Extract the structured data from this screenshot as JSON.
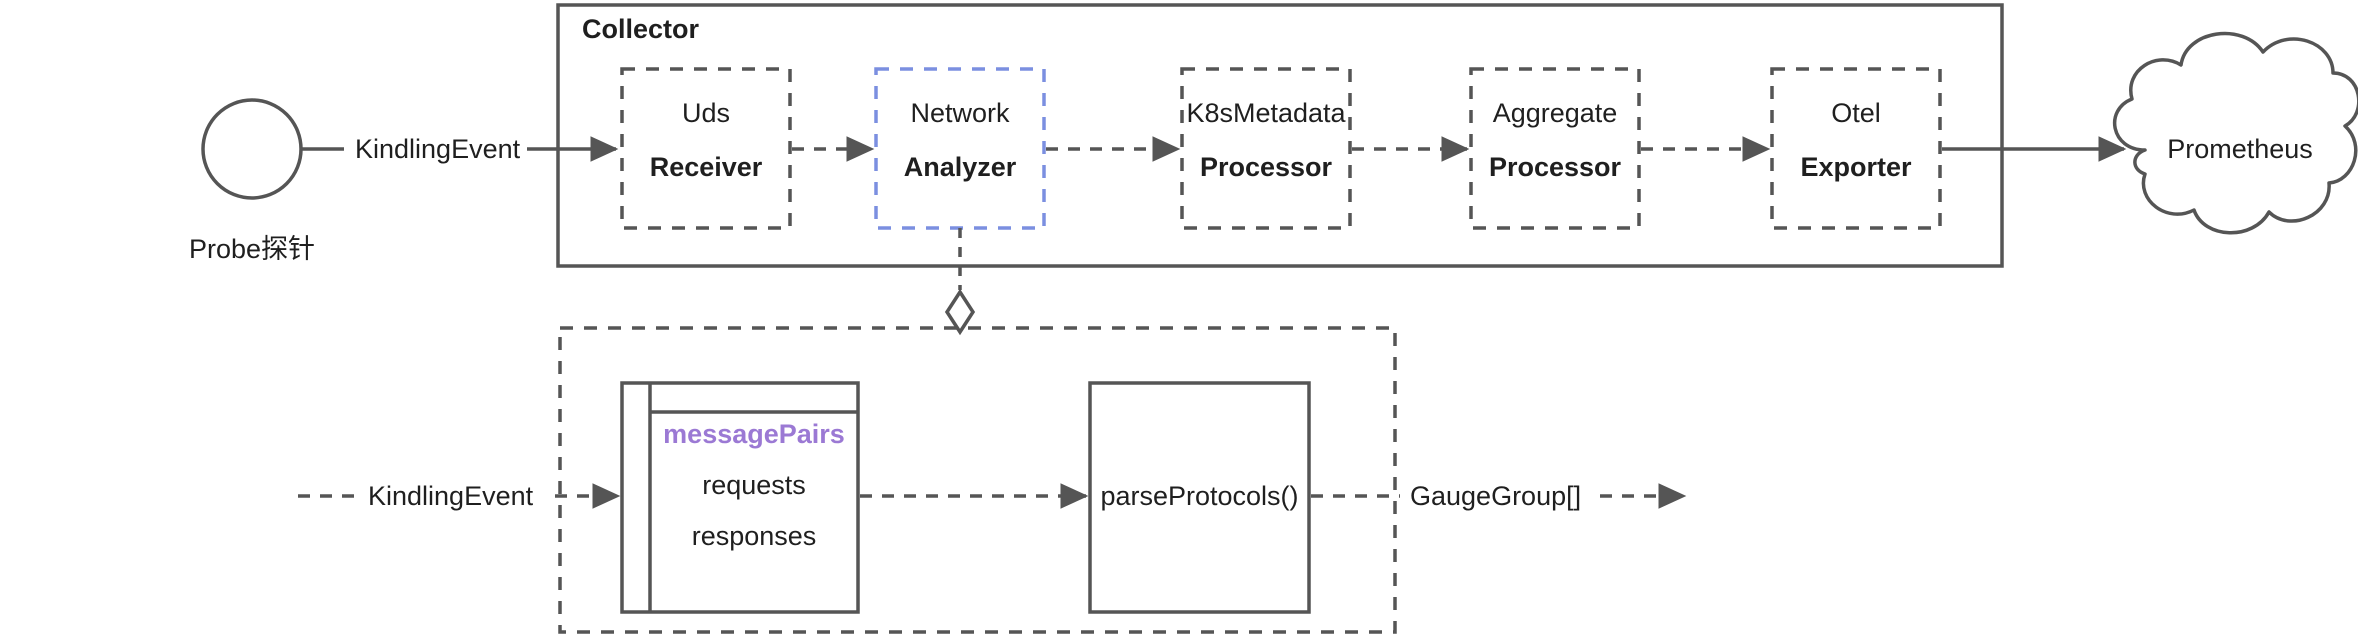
{
  "diagram": {
    "title_visible": false,
    "colors": {
      "stroke": "#555555",
      "text": "#1f1f1f",
      "accent_blue": "#7b8fe0",
      "accent_purple": "#9b79d4",
      "background": "#ffffff"
    }
  },
  "probe": {
    "shape": "circle",
    "caption": "Probe探针"
  },
  "collector": {
    "group_title": "Collector",
    "stages": [
      {
        "top": "Uds",
        "bottom": "Receiver",
        "border": "dashed-gray",
        "highlight": false
      },
      {
        "top": "Network",
        "bottom": "Analyzer",
        "border": "dashed-blue",
        "highlight": true
      },
      {
        "top": "K8sMetadata",
        "bottom": "Processor",
        "border": "dashed-gray",
        "highlight": false
      },
      {
        "top": "Aggregate",
        "bottom": "Processor",
        "border": "dashed-gray",
        "highlight": false
      },
      {
        "top": "Otel",
        "bottom": "Exporter",
        "border": "dashed-gray",
        "highlight": false
      }
    ]
  },
  "edges": {
    "probe_to_collector": "KindlingEvent",
    "detail_input": "KindlingEvent",
    "detail_output": "GaugeGroup[]"
  },
  "sink": {
    "shape": "cloud",
    "label": "Prometheus"
  },
  "detail": {
    "message_pairs": {
      "title": "messagePairs",
      "fields": [
        "requests",
        "responses"
      ]
    },
    "function_box": {
      "label": "parseProtocols()"
    },
    "link_marker": "aggregation-diamond"
  }
}
